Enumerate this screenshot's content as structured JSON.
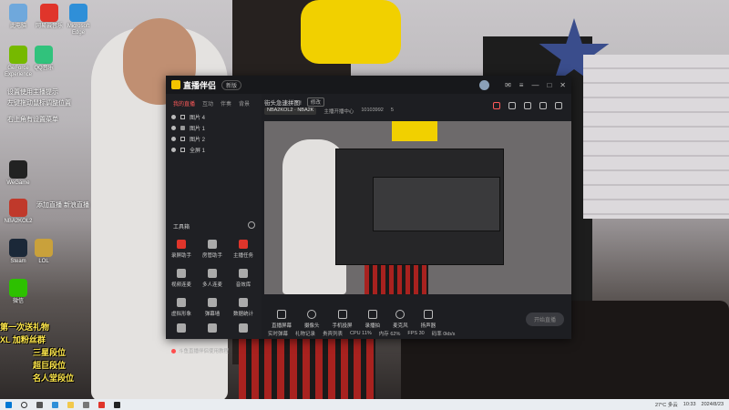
{
  "desktop": {
    "icons": [
      {
        "label": "此电脑",
        "color": "#6fa8dc"
      },
      {
        "label": "网易云音乐",
        "color": "#e0352b"
      },
      {
        "label": "Microsoft Edge",
        "color": "#2f8fd8"
      },
      {
        "label": "GeForce Experience",
        "color": "#76b900"
      },
      {
        "label": "QQ音乐",
        "color": "#31c27c"
      },
      {
        "label": "WeGame",
        "color": "#222"
      },
      {
        "label": "NBA2KOL2",
        "color": "#c0392b"
      },
      {
        "label": "Steam",
        "color": "#1b2838"
      },
      {
        "label": "LOL",
        "color": "#c9a13b"
      },
      {
        "label": "微信",
        "color": "#2dc100"
      }
    ],
    "overlay_lines": [
      "设置使用主播提示",
      "左键拖动鼠标调整位置",
      "右上角有设置菜单",
      "添加直播  新浪直播"
    ],
    "danmu": [
      "第一次送礼物",
      "XL 加粉丝群",
      "三星段位",
      "超巨段位",
      "名人堂段位",
      "10103992",
      "欢迎来到直播间!!!!"
    ]
  },
  "app": {
    "title": "直播伴侣",
    "version": "新版",
    "scene_tabs": [
      "我的直播",
      "互动",
      "伴奏",
      "背景"
    ],
    "sources": [
      "图片 4",
      "图片 1",
      "图片 2",
      "全屏 1"
    ],
    "toolbox_title": "工具箱",
    "tools": [
      {
        "label": "录屏助手",
        "color": "#e0352b"
      },
      {
        "label": "房管助手",
        "color": "#aaa"
      },
      {
        "label": "主播任务",
        "color": "#e0352b"
      },
      {
        "label": "视频连麦",
        "color": "#aaa"
      },
      {
        "label": "多人连麦",
        "color": "#aaa"
      },
      {
        "label": "音效库",
        "color": "#aaa"
      },
      {
        "label": "虚拟形象",
        "color": "#aaa"
      },
      {
        "label": "弹幕墙",
        "color": "#aaa"
      },
      {
        "label": "数据统计",
        "color": "#aaa"
      },
      {
        "label": "直播回放",
        "color": "#aaa"
      },
      {
        "label": "更多",
        "color": "#aaa"
      },
      {
        "label": "设置",
        "color": "#aaa"
      }
    ],
    "bottom_notice": "斗鱼直播伴侣使用教程",
    "stream": {
      "title": "街头急速拼图!",
      "edit": "修改",
      "category": "NBA2KOL2 · NBA2K",
      "center": "主播开播中心",
      "room_id": "10103992",
      "viewer": "5"
    },
    "controls": [
      "直播屏幕",
      "摄像头",
      "手机投屏",
      "录播拍",
      "麦克风",
      "扬声器"
    ],
    "go_live": "开始直播",
    "chat_strip": [
      "实时弹幕",
      "礼物记录",
      "贵宾列表",
      "CPU 11%",
      "内存 62%",
      "FPS 30",
      "码率 0kb/s"
    ]
  },
  "taskbar": {
    "weather": "27°C 多云",
    "time": "10:33",
    "date": "2024/8/23"
  }
}
